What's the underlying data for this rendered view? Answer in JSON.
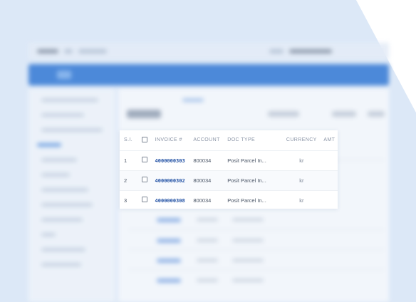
{
  "table": {
    "headers": {
      "si": "S.I.",
      "invoice": "INVOICE #",
      "account": "ACCOUNT",
      "doc_type": "DOC TYPE",
      "currency": "CURRENCY",
      "amount": "AMT"
    },
    "rows": [
      {
        "si": "1",
        "invoice": "4000000303",
        "account": "800034",
        "doc_type": "Posit Parcel In...",
        "currency": "kr"
      },
      {
        "si": "2",
        "invoice": "4000000302",
        "account": "800034",
        "doc_type": "Posit Parcel In...",
        "currency": "kr"
      },
      {
        "si": "3",
        "invoice": "4000000308",
        "account": "800034",
        "doc_type": "Posit Parcel In...",
        "currency": "kr"
      }
    ]
  },
  "colors": {
    "background": "#dce8f7",
    "header_blue": "#3d7fd6",
    "link_blue": "#1f4fa3"
  },
  "icons": {
    "checkbox": "checkbox-icon"
  }
}
